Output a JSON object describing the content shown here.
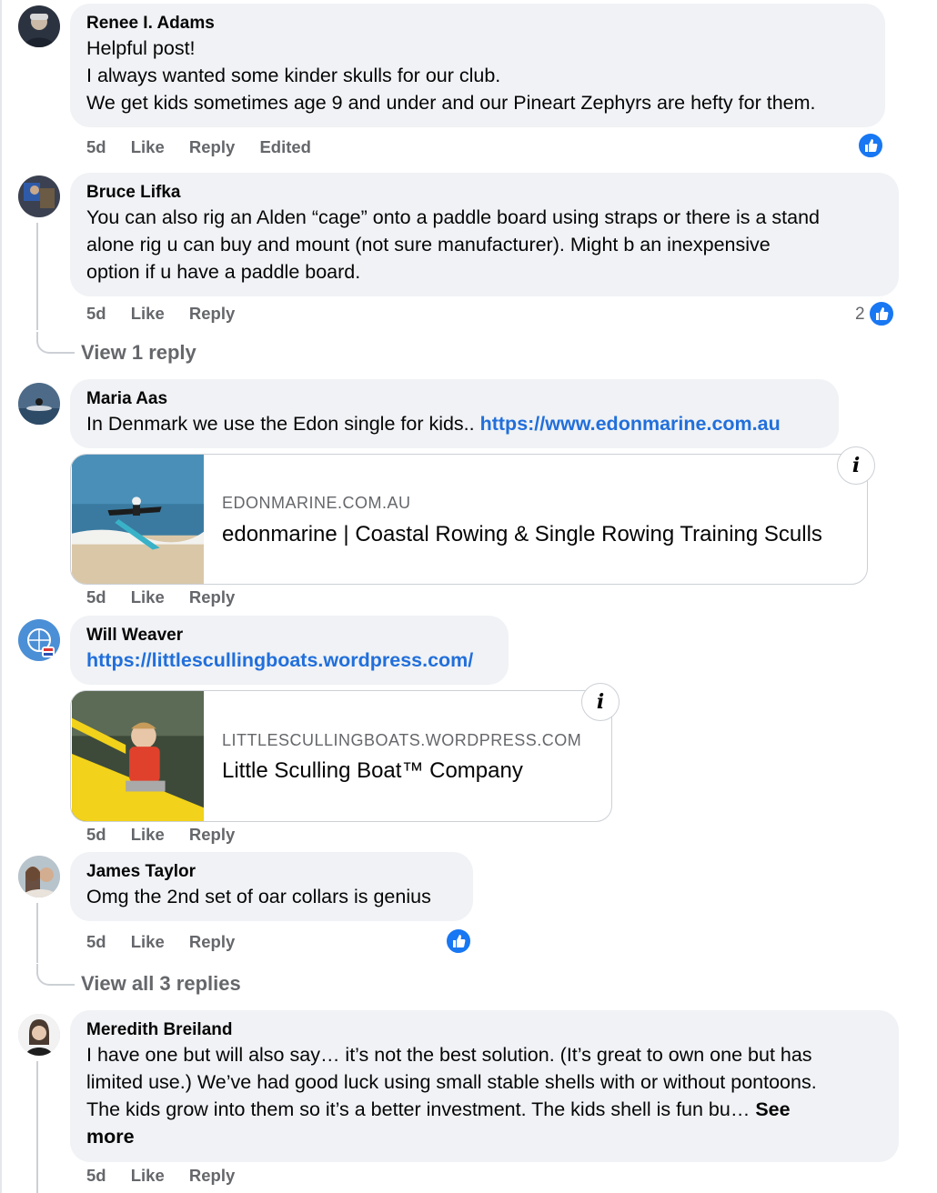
{
  "comments": [
    {
      "author": "Renee I. Adams",
      "lines": [
        "Helpful post!",
        "I always wanted some kinder skulls for our club.",
        "We get kids sometimes age 9 and under and our Pineart Zephyrs are hefty for them."
      ],
      "time": "5d",
      "like": "Like",
      "reply": "Reply",
      "edited": "Edited"
    },
    {
      "author": "Bruce Lifka",
      "lines": [
        "You can also rig an Alden “cage” onto a paddle board using straps or there is a stand",
        "alone rig u can buy and mount (not sure manufacturer). Might b an inexpensive",
        "option if u have a paddle board."
      ],
      "time": "5d",
      "like": "Like",
      "reply": "Reply",
      "reaction_count": "2",
      "view_replies": "View 1 reply"
    },
    {
      "author": "Maria Aas",
      "text": "In Denmark we use the Edon single for kids.. ",
      "link_text": "https://www.edonmarine.com.au",
      "card": {
        "domain": "EDONMARINE.COM.AU",
        "title": "edonmarine | Coastal Rowing & Single Rowing Training Sculls"
      },
      "time": "5d",
      "like": "Like",
      "reply": "Reply"
    },
    {
      "author": "Will Weaver",
      "link_text": "https://littlescullingboats.wordpress.com/",
      "card": {
        "domain": "LITTLESCULLINGBOATS.WORDPRESS.COM",
        "title": "Little Sculling Boat™ Company"
      },
      "time": "5d",
      "like": "Like",
      "reply": "Reply"
    },
    {
      "author": "James Taylor",
      "text": "Omg the 2nd set of oar collars is genius",
      "time": "5d",
      "like": "Like",
      "reply": "Reply",
      "view_replies": "View all 3 replies"
    },
    {
      "author": "Meredith Breiland",
      "lines": [
        "I have one but will also say… it’s not the best solution. (It’s great to own one but has",
        "limited use.) We’ve had good luck using small stable shells with or without pontoons.",
        "The kids grow into them so it’s a better investment. The kids shell is fun bu… "
      ],
      "see": "See",
      "more": "more",
      "time": "5d",
      "like": "Like",
      "reply": "Reply"
    }
  ],
  "icons": {
    "like_reaction": "thumbs-up-icon",
    "info": "info-icon"
  },
  "colors": {
    "bubble": "#f0f2f5",
    "link": "#216fdb",
    "like_blue": "#1877f2",
    "meta_grey": "#65676b"
  },
  "info_glyph": "i"
}
